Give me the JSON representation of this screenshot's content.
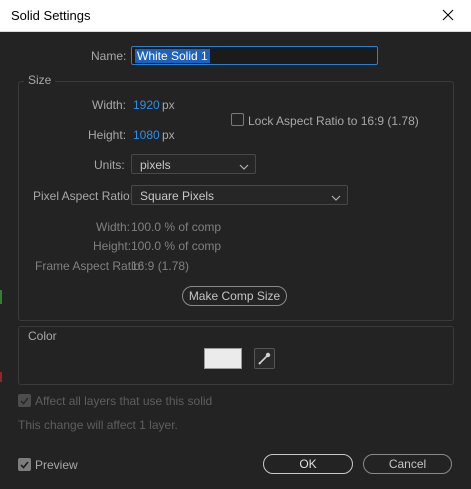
{
  "window": {
    "title": "Solid Settings"
  },
  "name_field": {
    "label": "Name:",
    "value": "White Solid 1"
  },
  "size": {
    "group_label": "Size",
    "width_label": "Width:",
    "width_value": "1920",
    "width_unit": "px",
    "height_label": "Height:",
    "height_value": "1080",
    "height_unit": "px",
    "lock_label": "Lock Aspect Ratio to 16:9 (1.78)",
    "units_label": "Units:",
    "units_value": "pixels",
    "par_label": "Pixel Aspect Ratio:",
    "par_value": "Square Pixels",
    "info_width_label": "Width:",
    "info_width_value": "100.0 % of comp",
    "info_height_label": "Height:",
    "info_height_value": "100.0 % of comp",
    "frame_ar_label": "Frame Aspect Ratio:",
    "frame_ar_value": "16:9 (1.78)",
    "make_comp_size_label": "Make Comp Size"
  },
  "color": {
    "group_label": "Color",
    "swatch_hex": "#ebebeb"
  },
  "affect_all_label": "Affect all layers that use this solid",
  "change_note": "This change will affect 1 layer.",
  "preview_label": "Preview",
  "ok_label": "OK",
  "cancel_label": "Cancel",
  "colors": {
    "accent": "#2f8ee6",
    "background": "#232323"
  }
}
